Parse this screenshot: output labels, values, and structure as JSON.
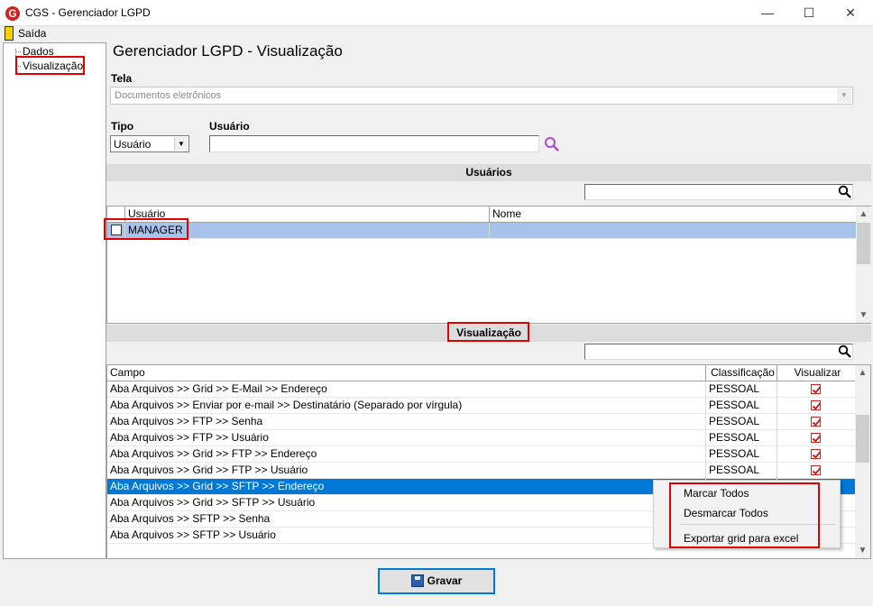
{
  "window": {
    "app_logo": "G",
    "title": "CGS - Gerenciador LGPD",
    "minimize": "—",
    "maximize": "☐",
    "close": "✕"
  },
  "menu": {
    "exit_label": "Saída"
  },
  "tree": {
    "items": [
      "Dados",
      "Visualização"
    ]
  },
  "page": {
    "title": "Gerenciador LGPD - Visualização"
  },
  "form": {
    "tela_label": "Tela",
    "tela_value": "Documentos eletrônicos",
    "tipo_label": "Tipo",
    "tipo_value": "Usuário",
    "usuario_label": "Usuário",
    "usuario_value": ""
  },
  "usuarios_section": {
    "header": "Usuários",
    "search_value": "",
    "columns": [
      "Usuário",
      "Nome"
    ],
    "rows": [
      {
        "usuario": "MANAGER",
        "nome": "",
        "checked": false
      }
    ]
  },
  "visualizacao_section": {
    "header": "Visualização",
    "search_value": "",
    "columns": [
      "Campo",
      "Classificação",
      "Visualizar"
    ],
    "rows": [
      {
        "campo": "Aba Arquivos >> Grid >> E-Mail >> Endereço",
        "classificacao": "PESSOAL",
        "visualizar": true
      },
      {
        "campo": "Aba Arquivos >> Enviar por e-mail >> Destinatário (Separado por vírgula)",
        "classificacao": "PESSOAL",
        "visualizar": true
      },
      {
        "campo": "Aba Arquivos >> FTP >> Senha",
        "classificacao": "PESSOAL",
        "visualizar": true
      },
      {
        "campo": "Aba Arquivos >> FTP >> Usuário",
        "classificacao": "PESSOAL",
        "visualizar": true
      },
      {
        "campo": "Aba Arquivos >> Grid >> FTP >>  Endereço",
        "classificacao": "PESSOAL",
        "visualizar": true
      },
      {
        "campo": "Aba Arquivos >> Grid >> FTP >> Usuário",
        "classificacao": "PESSOAL",
        "visualizar": true
      },
      {
        "campo": "Aba Arquivos >> Grid >> SFTP >> Endereço",
        "classificacao": "",
        "visualizar": false
      },
      {
        "campo": "Aba Arquivos >> Grid >> SFTP >> Usuário",
        "classificacao": "",
        "visualizar": false
      },
      {
        "campo": "Aba Arquivos >> SFTP >> Senha",
        "classificacao": "",
        "visualizar": false
      },
      {
        "campo": "Aba Arquivos >> SFTP >> Usuário",
        "classificacao": "",
        "visualizar": false
      }
    ]
  },
  "context_menu": {
    "items": [
      "Marcar Todos",
      "Desmarcar Todos",
      "Exportar grid para excel"
    ]
  },
  "footer": {
    "save_label": "Gravar"
  },
  "colors": {
    "accent": "#0078d7",
    "highlight_box": "#e00000",
    "selection": "#0078d7",
    "checkbox": "#d02020"
  }
}
